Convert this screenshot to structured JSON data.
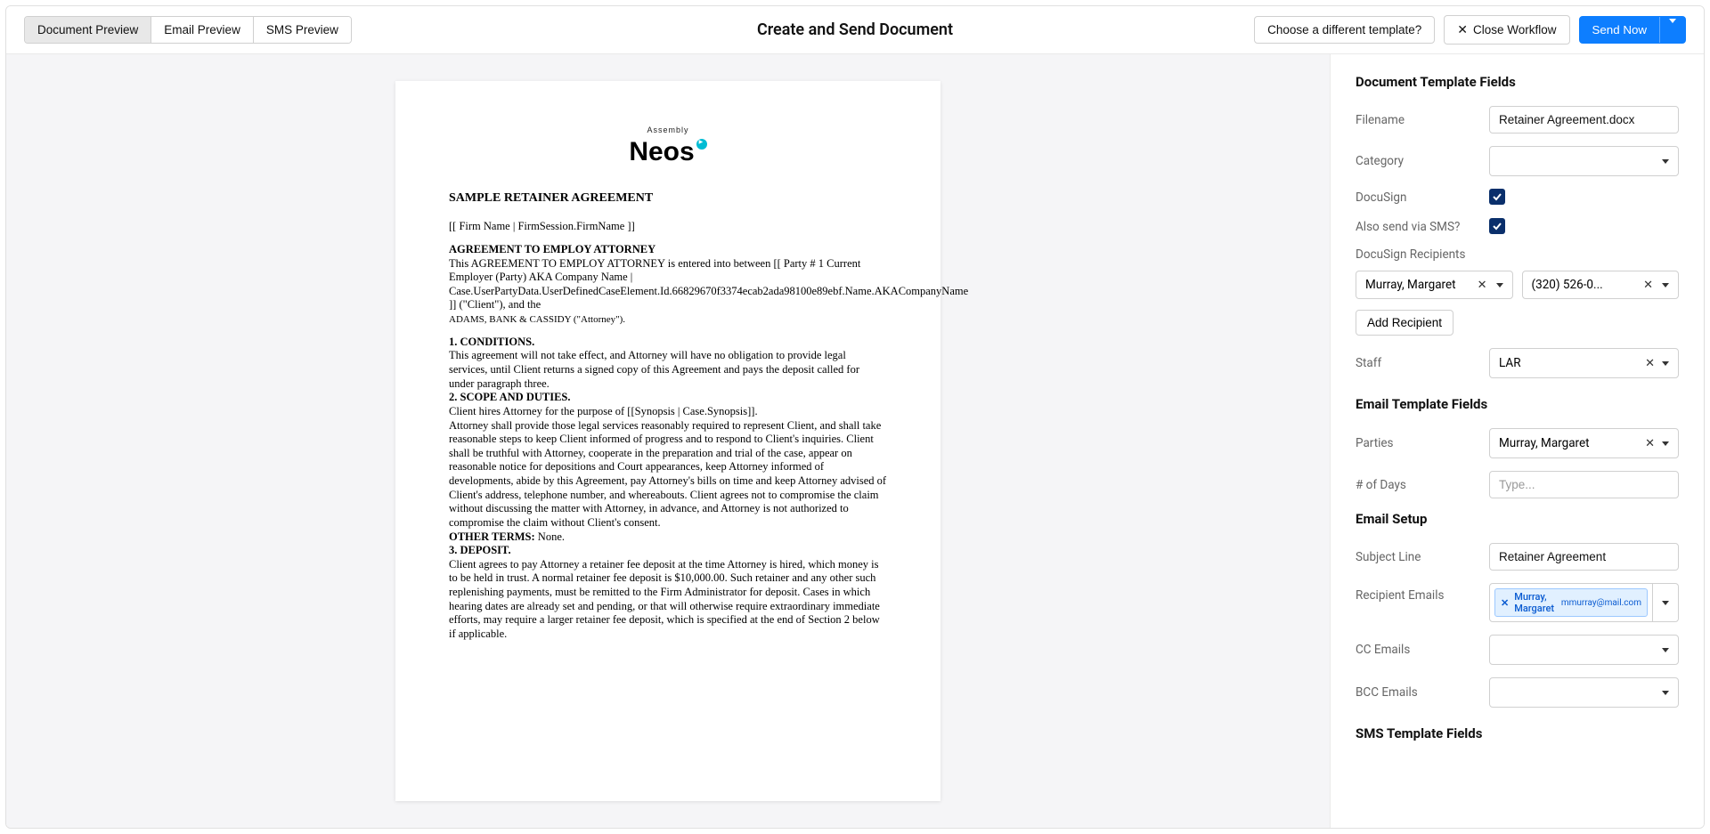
{
  "header": {
    "title": "Create and Send Document",
    "tabs": [
      "Document Preview",
      "Email Preview",
      "SMS Preview"
    ],
    "choose_template": "Choose a different template?",
    "close_workflow": "Close Workflow",
    "send_now": "Send Now"
  },
  "document": {
    "logo_sub": "Assembly",
    "logo_main": "Neos",
    "title": "SAMPLE RETAINER AGREEMENT",
    "line1": "[[ Firm Name | FirmSession.FirmName ]]",
    "sec1_head": "AGREEMENT TO EMPLOY ATTORNEY",
    "sec1_body": "This AGREEMENT TO EMPLOY ATTORNEY is entered into between [[ Party # 1 Current Employer (Party) AKA Company Name | Case.UserPartyData.UserDefinedCaseElement.Id.66829670f3374ecab2ada98100e89ebf.Name.AKACompanyName ]] (\"Client\"), and the",
    "sec1_small": "ADAMS, BANK & CASSIDY (\"Attorney\").",
    "cond_head": "1. CONDITIONS.",
    "cond_body": "This agreement will not take effect, and Attorney will have no obligation to provide legal services, until Client returns a signed copy of this Agreement and pays the deposit called for under paragraph three.",
    "scope_head": "2. SCOPE AND DUTIES.",
    "scope_l1": "Client hires Attorney for the purpose of [[Synopsis | Case.Synopsis]].",
    "scope_l2": "Attorney shall provide those legal services reasonably required to represent Client, and shall take reasonable steps to keep Client informed of progress and to respond to Client's inquiries. Client shall be truthful with Attorney, cooperate in the preparation and trial of the case, appear on reasonable notice for depositions and Court appearances, keep Attorney informed of developments, abide by this Agreement, pay Attorney's bills on time and keep Attorney advised of Client's address, telephone number, and whereabouts. Client agrees not to compromise the claim without discussing the matter with Attorney, in advance, and Attorney is not authorized to compromise the claim without Client's consent.",
    "other_label": "OTHER TERMS:",
    "other_value": "None.",
    "deposit_head": "3. DEPOSIT.",
    "deposit_body": "Client agrees to pay Attorney a retainer fee deposit at the time Attorney is hired, which money is to be held in trust. A normal retainer fee deposit is $10,000.00. Such retainer and any other such replenishing payments, must be remitted to the Firm Administrator for deposit. Cases in which hearing dates are already set and pending, or that will otherwise require extraordinary immediate efforts, may require a larger retainer fee deposit, which is specified at the end of Section 2 below if applicable."
  },
  "sidebar": {
    "section_doc": "Document Template Fields",
    "filename_label": "Filename",
    "filename_value": "Retainer Agreement.docx",
    "category_label": "Category",
    "docusign_label": "DocuSign",
    "sms_label": "Also send via SMS?",
    "recipients_label": "DocuSign Recipients",
    "recipient_name": "Murray, Margaret",
    "recipient_phone": "(320) 526-0...",
    "add_recipient": "Add Recipient",
    "staff_label": "Staff",
    "staff_value": "LAR",
    "section_email": "Email Template Fields",
    "parties_label": "Parties",
    "parties_value": "Murray, Margaret",
    "days_label": "# of Days",
    "days_placeholder": "Type...",
    "section_setup": "Email Setup",
    "subject_label": "Subject Line",
    "subject_value": "Retainer Agreement",
    "recip_emails_label": "Recipient Emails",
    "recip_tag_name": "Murray, Margaret",
    "recip_tag_email": "mmurray@mail.com",
    "cc_label": "CC Emails",
    "bcc_label": "BCC Emails",
    "section_sms": "SMS Template Fields"
  }
}
